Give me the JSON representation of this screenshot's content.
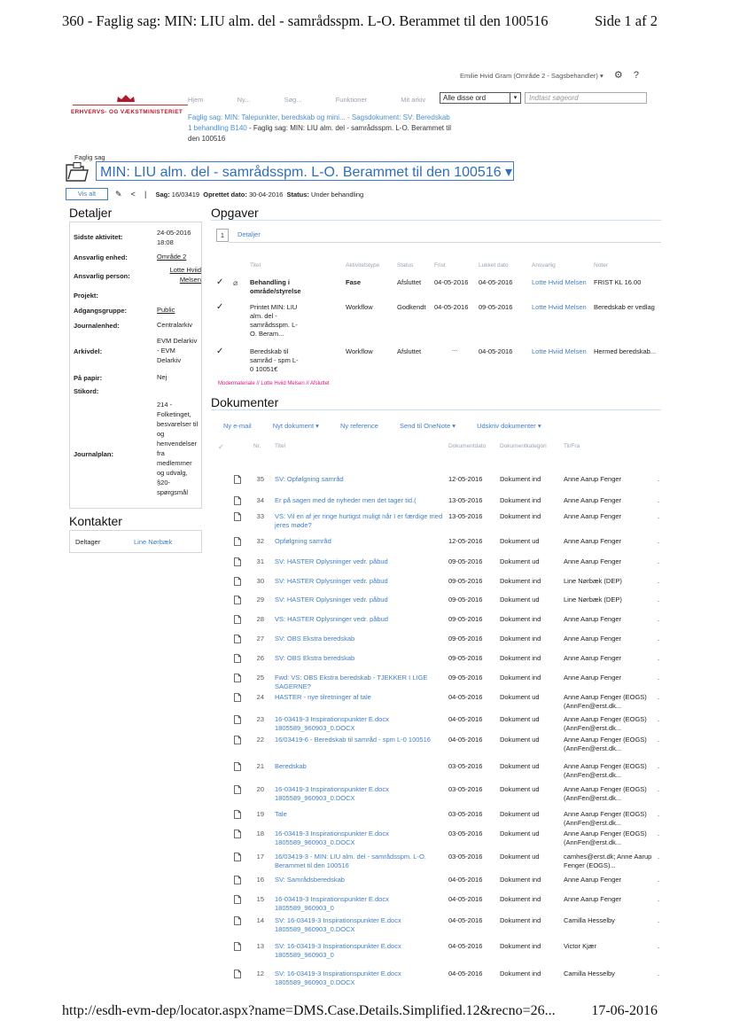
{
  "print_header": {
    "title": "360 - Faglig sag: MIN: LIU alm. del - samrådsspm. L-O. Berammet til den 100516",
    "page": "Side 1 af 2"
  },
  "print_footer": {
    "url": "http://esdh-evm-dep/locator.aspx?name=DMS.Case.Details.Simplified.12&recno=26...",
    "date": "17-06-2016"
  },
  "userbar": {
    "user": "Emilie Hvid Gram (Område 2 - Sagsbehandler) ▾",
    "gear": "⚙",
    "help": "?"
  },
  "logo": {
    "text": "ERHVERVS- OG VÆKSTMINISTERIET",
    "color": "#b3172b"
  },
  "nav": {
    "items": [
      "Hjem",
      "Ny...",
      "Søg...",
      "Funktioner",
      "Mit arkiv"
    ]
  },
  "search": {
    "scope": "Alle disse ord",
    "placeholder": "Indtast søgeord",
    "arrow": "▾"
  },
  "breadcrumb": {
    "part1": "Faglig sag: MIN: Talepunkter, beredskab og mini...",
    "sep1": " - ",
    "part2": "Sagsdokument: SV: Beredskab 1 behandling B140",
    "sep2": " - ",
    "current": "Faglig sag: MIN: LIU alm. del - samrådsspm. L-O. Berammet til den 100516"
  },
  "case": {
    "type_label": "Faglig sag",
    "title": "MIN: LIU alm. del - samrådsspm. L-O. Berammet til den 100516 ▾",
    "vis_alt": "Vis alt",
    "pin_icon": "✎",
    "share_icon": "<",
    "divider": "|",
    "sag_label": "Sag:",
    "sag_value": "16/03419",
    "oprettet_label": "Oprettet dato:",
    "oprettet_value": "30-04-2016",
    "status_label": "Status:",
    "status_value": "Under behandling"
  },
  "details": {
    "heading": "Detaljer",
    "rows": [
      {
        "label": "Sidste aktivitet:",
        "value": "24-05-2016 18:08"
      },
      {
        "label": "Ansvarlig enhed:",
        "value": "Område 2"
      },
      {
        "label": "Ansvarlig person:",
        "value": "Lotte Hviid Melsen"
      },
      {
        "label": "Projekt:",
        "value": ""
      },
      {
        "label": "Adgangsgruppe:",
        "value": "Public"
      },
      {
        "label": "Journalenhed:",
        "value": "Centralarkiv"
      },
      {
        "label": "Arkivdel:",
        "value": "EVM Delarkiv - EVM Delarkiv"
      },
      {
        "label": "På papir:",
        "value": "Nej"
      },
      {
        "label": "Stikord:",
        "value": ""
      },
      {
        "label": "Journalplan:",
        "value": "214 - Folketinget, besvarelser til og henvendelser fra medlemmer og udvalg, §20-spørgsmål"
      }
    ]
  },
  "contacts": {
    "heading": "Kontakter",
    "role": "Deltager",
    "name": "Line Nørbæk"
  },
  "tasks": {
    "heading": "Opgaver",
    "tab_number": "1",
    "tab_label": "Detaljer",
    "columns": [
      "Titel",
      "Aktivitetstype",
      "Status",
      "Frist",
      "Lukket dato",
      "Ansvarlig",
      "Noter"
    ],
    "rows": [
      {
        "check": "✓",
        "clip": "⌀",
        "title": "Behandling i område/styrelse",
        "type": "Fase",
        "status": "Afsluttet",
        "frist": "04-05-2016",
        "lukket": "04-05-2016",
        "ansvarlig": "Lotte Hviid Melsen",
        "noter": "FRIST KL 16.00"
      },
      {
        "check": "✓",
        "clip": "",
        "title": "Printet MIN: LIU alm. del - samrådsspm. L-O. Beram...",
        "type": "Workflow",
        "status": "Godkendt",
        "frist": "04-05-2016",
        "lukket": "09-05-2016",
        "ansvarlig": "Lotte Hviid Melsen",
        "noter": "Beredskab er vedlag"
      },
      {
        "check": "✓",
        "clip": "",
        "title": "Beredskab til samråd - spm L-0 10051€",
        "type": "Workflow",
        "status": "Afsluttet",
        "frist": "...",
        "lukket": "04-05-2016",
        "ansvarlig": "Lotte Hviid Melsen",
        "noter": "Hermed beredskab..."
      }
    ],
    "footer": "Modermateriale // Lotte Hviid Melsen // Afsluttet"
  },
  "documents": {
    "heading": "Dokumenter",
    "toolbar": [
      "Ny e-mail",
      "Nyt dokument ▾",
      "Ny reference",
      "Send til OneNote ▾",
      "Udskriv dokumenter ▾"
    ],
    "columns": {
      "check": "✓",
      "nr": "Nr.",
      "title": "Titel",
      "date": "Dokumentdato",
      "cat": "Dokumentkategori",
      "tf": "Til/Fra"
    },
    "rows": [
      {
        "nr": "35",
        "title": "SV: Opfølgning samråd",
        "date": "12-05-2016",
        "cat": "Dokument ind",
        "tf": "Anne Aarup Fenger",
        "dot": "."
      },
      {
        "nr": "34",
        "title": "Er på sagen med de nyheder men det tager tid.(",
        "date": "13-05-2016",
        "cat": "Dokument ind",
        "tf": "Anne Aarup Fenger",
        "dot": "."
      },
      {
        "nr": "33",
        "title": "VS: Vil en af jer ringe hurtigst muligt når I er færdige med jeres møde?",
        "date": "13-05-2016",
        "cat": "Dokument ind",
        "tf": "Anne Aarup Fenger",
        "dot": "."
      },
      {
        "nr": "32",
        "title": "Opfølgning samråd",
        "date": "12-05-2016",
        "cat": "Dokument ud",
        "tf": "Anne Aarup Fenger",
        "dot": "."
      },
      {
        "nr": "31",
        "title": "SV: HASTER Oplysninger vedr. påbud",
        "date": "09-05-2016",
        "cat": "Dokument ud",
        "tf": "Anne Aarup Fenger",
        "dot": "."
      },
      {
        "nr": "30",
        "title": "SV: HASTER Oplysninger vedr. påbud",
        "date": "09-05-2016",
        "cat": "Dokument ind",
        "tf": "Line Nørbæk (DEP)",
        "dot": "."
      },
      {
        "nr": "29",
        "title": "SV: HASTER Oplysninger vedr. påbud",
        "date": "09-05-2016",
        "cat": "Dokument ud",
        "tf": "Line Nørbæk (DEP)",
        "dot": "."
      },
      {
        "nr": "28",
        "title": "VS: HASTER Oplysninger vedr. påbud",
        "date": "09-05-2016",
        "cat": "Dokument ind",
        "tf": "Anne Aarup Fenger",
        "dot": "."
      },
      {
        "nr": "27",
        "title": "SV: OBS Ekstra beredskab",
        "date": "09-05-2016",
        "cat": "Dokument ind",
        "tf": "Anne Aarup Fenger",
        "dot": "."
      },
      {
        "nr": "26",
        "title": "SV: OBS Ekstra beredskab",
        "date": "09-05-2016",
        "cat": "Dokument ind",
        "tf": "Anne Aarup Fenger",
        "dot": "."
      },
      {
        "nr": "25",
        "title": "Fwd: VS: OBS Ekstra beredskab - TJEKKER I LIGE SAGERNE?",
        "date": "09-05-2016",
        "cat": "Dokument ind",
        "tf": "Anne Aarup Fenger",
        "dot": "."
      },
      {
        "nr": "24",
        "title": "HASTER - nye tilretninger af tale",
        "date": "04-05-2016",
        "cat": "Dokument ud",
        "tf": "Anne Aarup Fenger (EOGS) (AnnFen@erst.dk...",
        "dot": "."
      },
      {
        "nr": "23",
        "title": "16-03419-3 Inspirationspunkter E.docx 1805589_960903_0.DOCX",
        "date": "04-05-2016",
        "cat": "Dokument ud",
        "tf": "Anne Aarup Fenger (EOGS) (AnnFen@erst.dk...",
        "dot": "."
      },
      {
        "nr": "22",
        "title": "16/03419-6 - Beredskab til samråd - spm L-0 100516",
        "date": "04-05-2016",
        "cat": "Dokument ud",
        "tf": "Anne Aarup Fenger (EOGS) (AnnFen@erst.dk...",
        "dot": "."
      },
      {
        "nr": "21",
        "title": "Beredskab",
        "date": "03-05-2016",
        "cat": "Dokument ud",
        "tf": "Anne Aarup Fenger (EOGS) (AnnFen@erst.dk...",
        "dot": "."
      },
      {
        "nr": "20",
        "title": "16-03419-3 Inspirationspunkter E.docx 1805589_960903_0.DOCX",
        "date": "03-05-2016",
        "cat": "Dokument ud",
        "tf": "Anne Aarup Fenger (EOGS) (AnnFen@erst.dk...",
        "dot": "."
      },
      {
        "nr": "19",
        "title": "Tale",
        "date": "03-05-2016",
        "cat": "Dokument ud",
        "tf": "Anne Aarup Fenger (EOGS) (AnnFen@erst.dk...",
        "dot": "."
      },
      {
        "nr": "18",
        "title": "16-03419-3 Inspirationspunkter E.docx 1805589_960903_0.DOCX",
        "date": "03-05-2016",
        "cat": "Dokument ud",
        "tf": "Anne Aarup Fenger (EOGS) (AnnFen@erst.dk...",
        "dot": "."
      },
      {
        "nr": "17",
        "title": "16/03419-3 - MIN: LIU alm. del - samrådsspm. L-O. Berammet til den 100516",
        "date": "03-05-2016",
        "cat": "Dokument ud",
        "tf": "camhes@erst.dk; Anne Aarup Fenger (EOGS)...",
        "dot": "."
      },
      {
        "nr": "16",
        "title": "SV: Samrådsberedskab",
        "date": "04-05-2016",
        "cat": "Dokument ind",
        "tf": "Anne Aarup Fenger",
        "dot": "."
      },
      {
        "nr": "15",
        "title": "16-03419-3 Inspirationspunkter E.docx 1805589_960903_0",
        "date": "04-05-2016",
        "cat": "Dokument ind",
        "tf": "Anne Aarup Fenger",
        "dot": "."
      },
      {
        "nr": "14",
        "title": "SV: 16-03419-3 Inspirationspunkter E.docx 1805589_960903_0.DOCX",
        "date": "04-05-2016",
        "cat": "Dokument ind",
        "tf": "Camilla Hesselby",
        "dot": "."
      },
      {
        "nr": "13",
        "title": "SV: 16-03419-3 Inspirationspunkter E.docx 1805589_960903_0",
        "date": "04-05-2016",
        "cat": "Dokument ind",
        "tf": "Victor Kjær",
        "dot": "."
      },
      {
        "nr": "12",
        "title": "SV: 16-03419-3 Inspirationspunkter E.docx 1805589_960903_0.DOCX",
        "date": "04-05-2016",
        "cat": "Dokument ind",
        "tf": "Camilla Hesselby",
        "dot": "."
      }
    ]
  }
}
